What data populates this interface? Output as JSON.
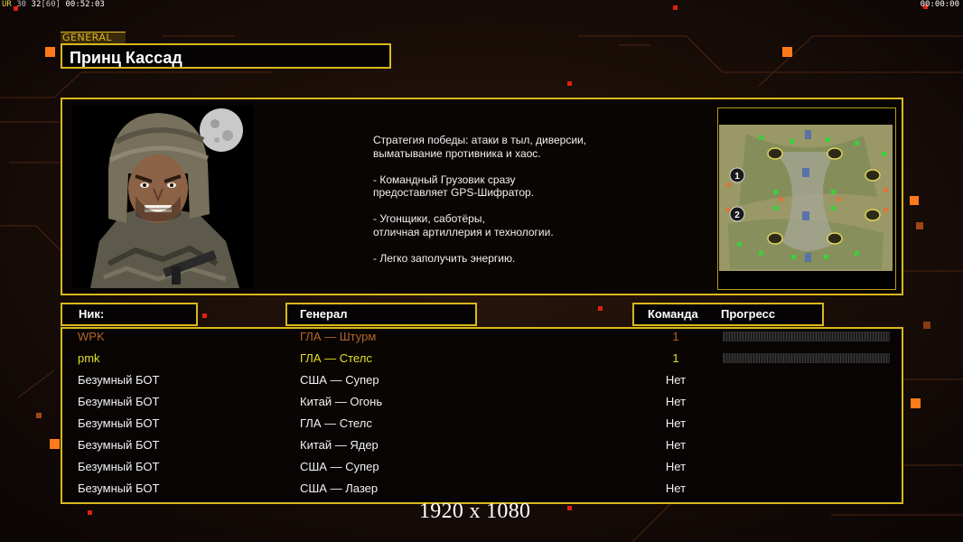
{
  "topbar": {
    "left_a": "UR",
    "left_b": "30",
    "left_c": "32",
    "left_d": "[60]",
    "left_time": "00:52:03",
    "right_time": "00:00:00"
  },
  "general_tag": "GENERAL",
  "general_name": "Принц Кассад",
  "description": [
    "Стратегия победы: атаки в тыл, диверсии,\n выматывание противника и хаос.",
    "- Командный Грузовик сразу\nпредоставляет GPS-Шифратор.",
    "- Угонщики, саботёры,\nотличная артиллерия и технологии.",
    "- Легко заполучить энергию."
  ],
  "headers": {
    "nick": "Ник:",
    "general": "Генерал",
    "team": "Команда",
    "progress": "Прогресс"
  },
  "players": [
    {
      "nick": "WPK",
      "general": "ГЛА — Штурм",
      "team": "1",
      "progress": 0,
      "color": "#b5652a",
      "has_progress": true
    },
    {
      "nick": "pmk",
      "general": "ГЛА — Стелс",
      "team": "1",
      "progress": 0,
      "color": "#e6e023",
      "has_progress": true
    },
    {
      "nick": "Безумный БОТ",
      "general": "США — Супер",
      "team": "Нет",
      "color": "#f2f2f2",
      "has_progress": false
    },
    {
      "nick": "Безумный БОТ",
      "general": "Китай — Огонь",
      "team": "Нет",
      "color": "#f2f2f2",
      "has_progress": false
    },
    {
      "nick": "Безумный БОТ",
      "general": "ГЛА — Стелс",
      "team": "Нет",
      "color": "#f2f2f2",
      "has_progress": false
    },
    {
      "nick": "Безумный БОТ",
      "general": "Китай — Ядер",
      "team": "Нет",
      "color": "#f2f2f2",
      "has_progress": false
    },
    {
      "nick": "Безумный БОТ",
      "general": "США — Супер",
      "team": "Нет",
      "color": "#f2f2f2",
      "has_progress": false
    },
    {
      "nick": "Безумный БОТ",
      "general": "США — Лазер",
      "team": "Нет",
      "color": "#f2f2f2",
      "has_progress": false
    }
  ],
  "minimap": {
    "start_labels": [
      "1",
      "2"
    ]
  },
  "resolution_label": "1920 x 1080",
  "colors": {
    "accent_gold": "#d9b81c",
    "background": "#140b08",
    "orange_square": "#ff7a1a",
    "red_square": "#e02010"
  }
}
